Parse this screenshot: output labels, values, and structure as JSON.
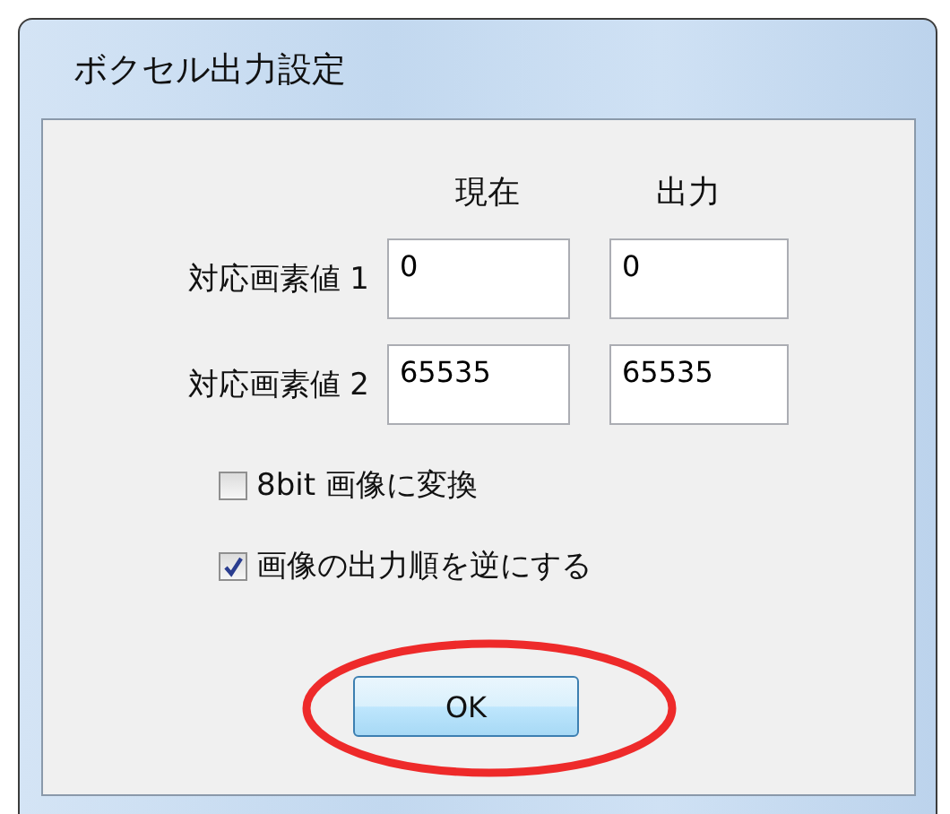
{
  "window": {
    "title": "ボクセル出力設定"
  },
  "columns": [
    "現在",
    "出力"
  ],
  "rows": [
    {
      "label": "対応画素値 1",
      "current": "0",
      "output": "0"
    },
    {
      "label": "対応画素値 2",
      "current": "65535",
      "output": "65535"
    }
  ],
  "options": [
    {
      "label": "8bit 画像に変換",
      "checked": false
    },
    {
      "label": "画像の出力順を逆にする",
      "checked": true
    }
  ],
  "button": {
    "label": "OK",
    "highlighted": true
  }
}
